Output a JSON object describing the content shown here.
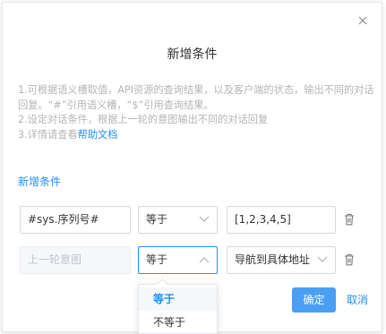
{
  "dialog": {
    "title": "新增条件",
    "tips": {
      "line1": "1.可根据语义槽取值，API资源的查询结果，以及客户端的状态，输出不同的对话回复。“#”引用语义槽，“$”引用查询结果。",
      "line2": "2.设定对话条件，根据上一轮的意图输出不同的对话回复",
      "line3_prefix": "3.详情请查看",
      "line3_link": "帮助文档"
    },
    "section_title": "新增条件",
    "conditions": [
      {
        "variable": "#sys.序列号#",
        "operator": "等于",
        "value": "[1,2,3,4,5]"
      },
      {
        "variable_placeholder": "上一轮意图",
        "operator": "等于",
        "value": "导航到具体地址"
      }
    ],
    "operator_options": [
      "等于",
      "不等于"
    ],
    "confirm_label": "确定",
    "cancel_label": "取消"
  },
  "colors": {
    "accent": "#1f8ff6",
    "primary_button": "#4a9ff5",
    "hint_text": "#b5b5b5"
  }
}
